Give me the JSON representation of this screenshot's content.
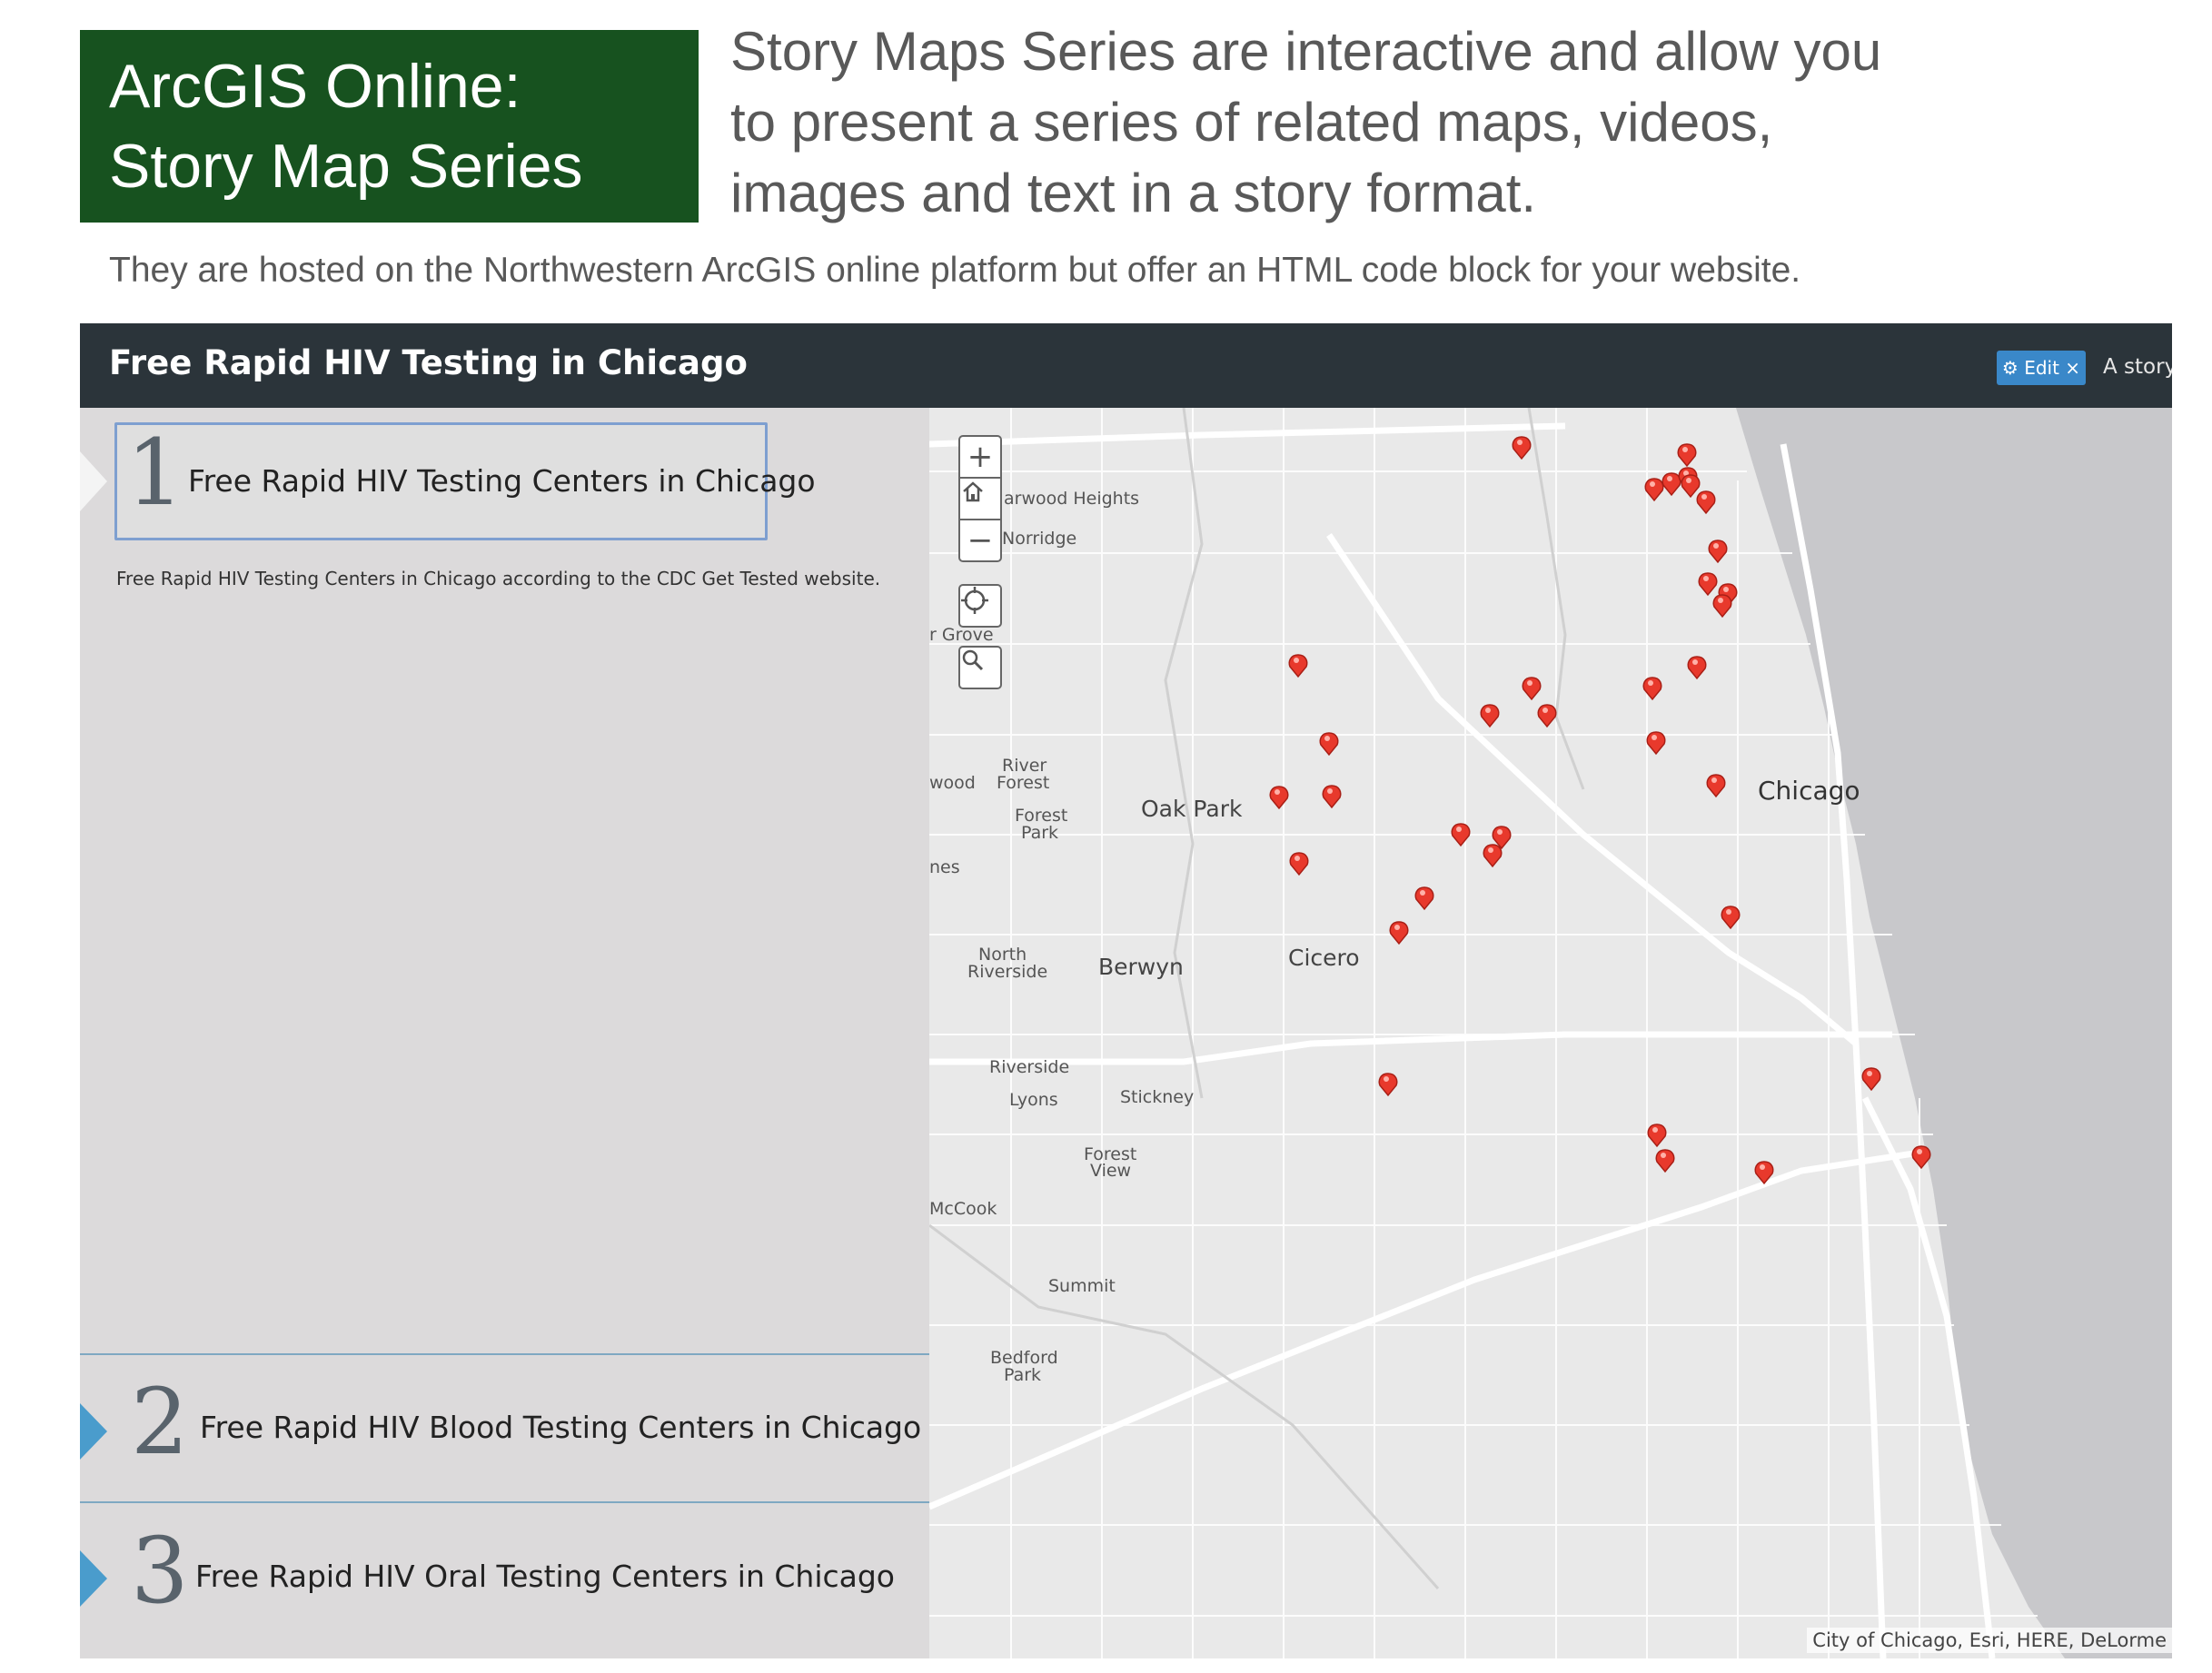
{
  "title_box": {
    "line1": "ArcGIS Online:",
    "line2": "Story Map Series",
    "background": "#17521f"
  },
  "intro": {
    "line1": "Story Maps Series are interactive and allow you",
    "line2": "to present a series of related maps, videos,",
    "line3": "images and text in a story format."
  },
  "subline": "They are hosted on the Northwestern ArcGIS online platform but offer an HTML code block for your website.",
  "app": {
    "title": "Free Rapid HIV Testing in Chicago",
    "edit_label": "Edit ×",
    "tagline": "A story",
    "header_color": "#2b343a"
  },
  "entries": [
    {
      "number": "1",
      "title": "Free Rapid HIV Testing Centers in Chicago",
      "active": true,
      "description": "Free Rapid HIV Testing Centers in Chicago according to the CDC Get Tested website."
    },
    {
      "number": "2",
      "title": "Free Rapid HIV Blood Testing Centers in Chicago",
      "active": false
    },
    {
      "number": "3",
      "title": "Free Rapid HIV Oral Testing Centers in Chicago",
      "active": false
    }
  ],
  "map": {
    "controls": {
      "zoom_in": "+",
      "zoom_out": "−"
    },
    "places": {
      "harwood": "arwood Heights",
      "norridge": "Norridge",
      "grove": "r Grove",
      "river_forest_1": "River",
      "river_forest_2": "Forest",
      "wood": "wood",
      "forest_park_1": "Forest",
      "forest_park_2": "Park",
      "oak_park": "Oak Park",
      "chicago": "Chicago",
      "nes": "nes",
      "north_riverside_1": "North",
      "north_riverside_2": "Riverside",
      "berwyn": "Berwyn",
      "cicero": "Cicero",
      "riverside": "Riverside",
      "lyons": "Lyons",
      "stickney": "Stickney",
      "forest_view_1": "Forest",
      "forest_view_2": "View",
      "mccook": "McCook",
      "summit": "Summit",
      "bedford_1": "Bedford",
      "bedford_2": "Park"
    },
    "attribution": "City of Chicago, Esri, HERE, DeLorme",
    "marker_color": "#e8392c",
    "lake_color": "#c8c8cb"
  }
}
